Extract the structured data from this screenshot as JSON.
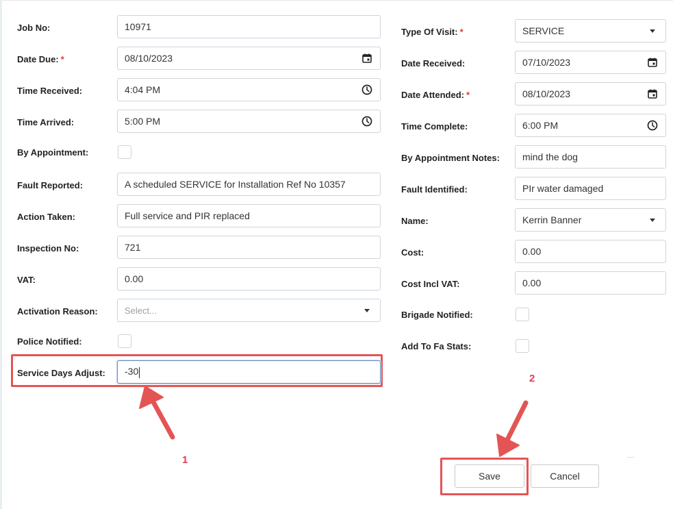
{
  "left": {
    "job_no": {
      "label": "Job No:",
      "value": "10971"
    },
    "date_due": {
      "label": "Date Due:",
      "required": "*",
      "value": "08/10/2023"
    },
    "time_received": {
      "label": "Time Received:",
      "value": "4:04 PM"
    },
    "time_arrived": {
      "label": "Time Arrived:",
      "value": "5:00 PM"
    },
    "by_appointment": {
      "label": "By Appointment:"
    },
    "fault_reported": {
      "label": "Fault Reported:",
      "value": "A scheduled SERVICE for Installation Ref No 10357"
    },
    "action_taken": {
      "label": "Action Taken:",
      "value": "Full service and PIR replaced"
    },
    "inspection_no": {
      "label": "Inspection No:",
      "value": "721"
    },
    "vat": {
      "label": "VAT:",
      "value": "0.00"
    },
    "activation_reason": {
      "label": "Activation Reason:",
      "placeholder": "Select..."
    },
    "police_notified": {
      "label": "Police Notified:"
    },
    "service_days_adjust": {
      "label": "Service Days Adjust:",
      "value": "-30"
    }
  },
  "right": {
    "type_of_visit": {
      "label": "Type Of Visit:",
      "required": "*",
      "value": "SERVICE"
    },
    "date_received": {
      "label": "Date Received:",
      "value": "07/10/2023"
    },
    "date_attended": {
      "label": "Date Attended:",
      "required": "*",
      "value": "08/10/2023"
    },
    "time_complete": {
      "label": "Time Complete:",
      "value": "6:00 PM"
    },
    "by_appointment_notes": {
      "label": "By Appointment Notes:",
      "value": "mind the dog"
    },
    "fault_identified": {
      "label": "Fault Identified:",
      "value": "PIr water damaged"
    },
    "name": {
      "label": "Name:",
      "value": "Kerrin Banner"
    },
    "cost": {
      "label": "Cost:",
      "value": "0.00"
    },
    "cost_incl_vat": {
      "label": "Cost Incl VAT:",
      "value": "0.00"
    },
    "brigade_notified": {
      "label": "Brigade Notified:"
    },
    "add_to_fa_stats": {
      "label": "Add To Fa Stats:"
    }
  },
  "buttons": {
    "save": "Save",
    "cancel": "Cancel"
  },
  "annotations": {
    "step1": "1",
    "step2": "2"
  },
  "colors": {
    "highlight": "#e45454",
    "step_number": "#e33b5b",
    "required": "#e03a3a"
  }
}
